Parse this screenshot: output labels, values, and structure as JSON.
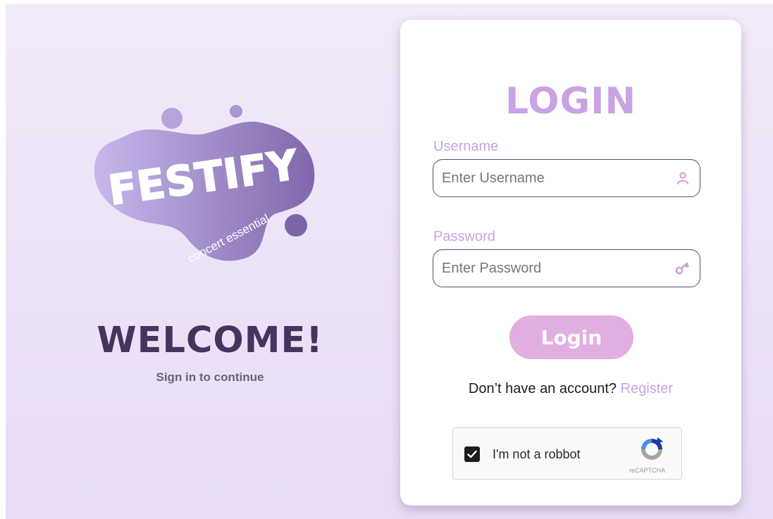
{
  "brand": {
    "logo_text": "FESTIFY",
    "tagline": "concert essential",
    "welcome": "WELCOME!",
    "subtitle": "Sign in to continue"
  },
  "form": {
    "title": "LOGIN",
    "username_label": "Username",
    "username_placeholder": "Enter Username",
    "password_label": "Password",
    "password_placeholder": "Enter Password",
    "submit_label": "Login",
    "register_prompt": "Don’t have an account?",
    "register_link": "Register"
  },
  "captcha": {
    "label": "I'm not a robbot",
    "checked": true,
    "brand": "reCAPTCHA"
  },
  "colors": {
    "accent": "#c9a3e4",
    "button": "#e2aee0",
    "heading_dark": "#46335e",
    "background": "#ede4f8"
  },
  "icons": {
    "username": "user-icon",
    "password": "key-icon",
    "captcha": "recaptcha-icon",
    "checkbox": "checkmark-icon"
  }
}
